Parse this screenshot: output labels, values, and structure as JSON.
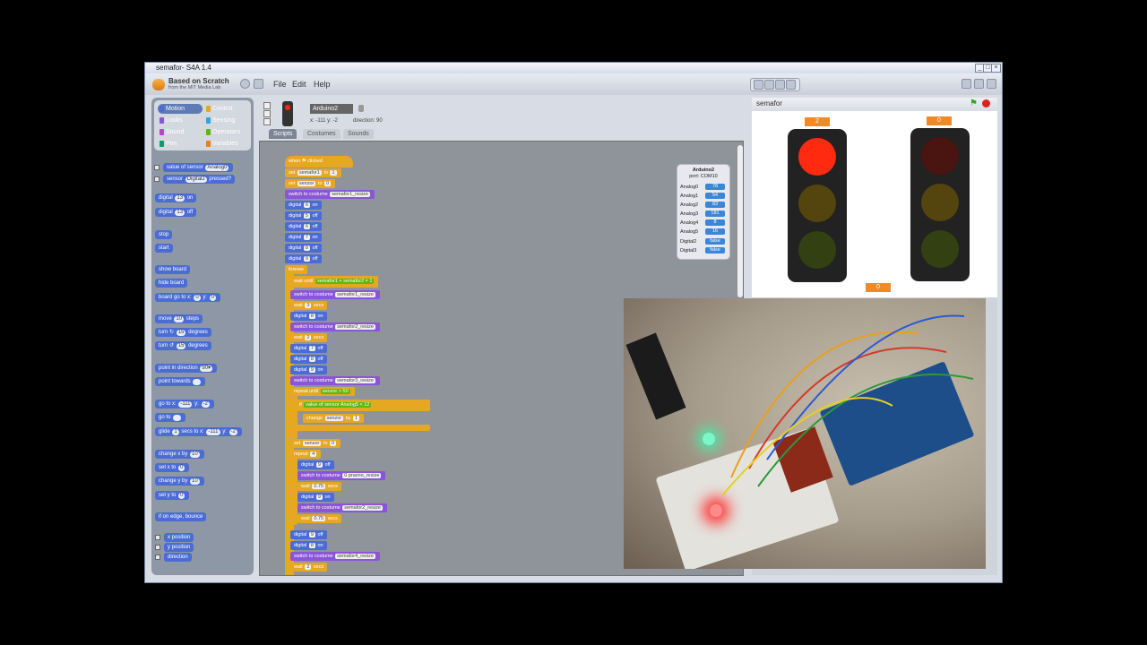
{
  "window": {
    "title": "semafor- S4A 1.4"
  },
  "header": {
    "logo_line1": "Based on Scratch",
    "logo_line2": "from the MIT Media Lab",
    "menu": [
      "File",
      "Edit",
      "Help"
    ]
  },
  "categories": [
    {
      "label": "Motion",
      "color": "#4a6cd4"
    },
    {
      "label": "Control",
      "color": "#e6a822"
    },
    {
      "label": "Looks",
      "color": "#8a55d7"
    },
    {
      "label": "Sensing",
      "color": "#2ca5e2"
    },
    {
      "label": "Sound",
      "color": "#bb42c3"
    },
    {
      "label": "Operators",
      "color": "#5cb712"
    },
    {
      "label": "Pen",
      "color": "#0e9a6c"
    },
    {
      "label": "Variables",
      "color": "#ee7d16"
    }
  ],
  "palette": {
    "value_of_sensor": "value of sensor",
    "analog0": "Analog0",
    "sensor": "sensor",
    "digital2": "Digital2",
    "pressed": "pressed?",
    "digital": "digital",
    "pin13": "13",
    "on": "on",
    "off": "off",
    "stop": "stop",
    "start": "start",
    "show_board": "show board",
    "hide_board": "hide board",
    "board_go_to": "board go to x:",
    "y": "y:",
    "zero": "0",
    "move": "move",
    "ten": "10",
    "steps": "steps",
    "turn_right": "turn ↻",
    "turn_left": "turn ↺",
    "fifteen": "15",
    "degrees": "degrees",
    "point_in_direction": "point in direction",
    "ninety": "90▾",
    "point_towards": "point towards",
    "go_to_x": "go to x:",
    "x_val": "-111",
    "y_val": "-2",
    "go_to": "go to",
    "glide": "glide",
    "one": "1",
    "secs_to_x": "secs to x:",
    "change_x_by": "change x by",
    "set_x_to": "set x to",
    "change_y_by": "change y by",
    "set_y_to": "set y to",
    "if_on_edge": "if on edge, bounce",
    "x_position": "x position",
    "y_position": "y position",
    "direction": "direction"
  },
  "sprite": {
    "name": "Arduino2",
    "coords": "x: -111  y: -2",
    "direction": "direction: 90",
    "tabs": [
      "Scripts",
      "Costumes",
      "Sounds"
    ]
  },
  "script": {
    "when_clicked": "when ⚑ clicked",
    "set": "set",
    "to": "to",
    "semafor1": "semafor1",
    "semafor2": "semafor2",
    "senzor": "senzor",
    "one": "1",
    "zero": "0",
    "switch_to_costume": "switch to costume",
    "c1": "semafor1_resize",
    "c2": "semafor2_resize",
    "c3": "semafor3_resize",
    "c4": "semafor4_resize",
    "c_prazno": "0 prazno_resize",
    "digital": "digital",
    "on": "on",
    "off": "off",
    "p6": "6",
    "p5": "5",
    "p7": "7",
    "p8": "8",
    "p9": "9",
    "forever": "forever",
    "wait_until": "wait until",
    "eq": "=",
    "wait": "wait",
    "secs": "secs",
    "three": "3",
    "two": "2",
    "repeat_until": "repeat until",
    "gt": ">",
    "fifty": "50",
    "if": "if",
    "value_of_sensor": "value of sensor",
    "analog5": "Analog5",
    "lt": "<",
    "twelve": "12",
    "change": "change",
    "by": "by",
    "repeat": "repeat",
    "four": "4",
    "v075": "0.75"
  },
  "watcher": {
    "title": "Arduino2",
    "port": "port: COM10",
    "rows": [
      {
        "label": "Analog0",
        "value": "78"
      },
      {
        "label": "Analog1",
        "value": "54"
      },
      {
        "label": "Analog2",
        "value": "83"
      },
      {
        "label": "Analog3",
        "value": "181"
      },
      {
        "label": "Analog4",
        "value": "8"
      },
      {
        "label": "Analog5",
        "value": "16"
      },
      {
        "label": "Digital2",
        "value": "false"
      },
      {
        "label": "Digital3",
        "value": "false"
      }
    ]
  },
  "stage": {
    "name": "semafor",
    "var_left": "2",
    "var_right": "0",
    "var_bottom": "0",
    "colors": {
      "red_on": "#ff2a10",
      "red_off": "#4a1410",
      "yellow_off": "#54440e",
      "green_off": "#334012"
    }
  }
}
